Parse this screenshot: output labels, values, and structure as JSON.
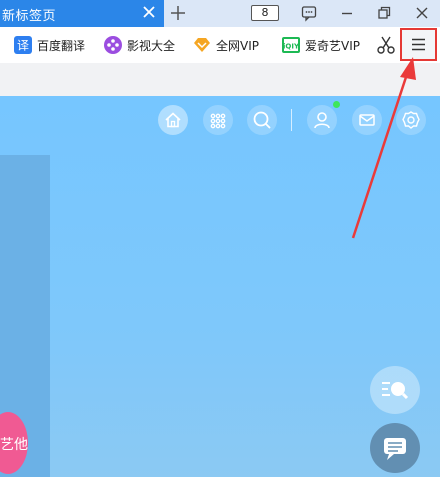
{
  "tab": {
    "title": "新标签页"
  },
  "toolbar": {
    "tab_count": "8"
  },
  "bookmarks": [
    {
      "label": "百度翻译",
      "icon": "translate-icon",
      "color": "#2e7ff0"
    },
    {
      "label": "影视大全",
      "icon": "film-reel-icon",
      "color": "#9b4de0"
    },
    {
      "label": "全网VIP",
      "icon": "vip-diamond-icon",
      "color": "#f5a623"
    },
    {
      "label": "爱奇艺VIP",
      "icon": "iqiyi-icon",
      "color": "#1db954"
    }
  ],
  "content": {
    "nav_icons": [
      "home-icon",
      "apps-grid-icon",
      "search-icon",
      "user-icon",
      "mail-icon",
      "settings-icon"
    ],
    "float_badge": "艺他"
  },
  "colors": {
    "tab_blue": "#2b86e8",
    "content_blue": "#76c6ff",
    "highlight_red": "#e53935",
    "online_green": "#3ee65b"
  }
}
